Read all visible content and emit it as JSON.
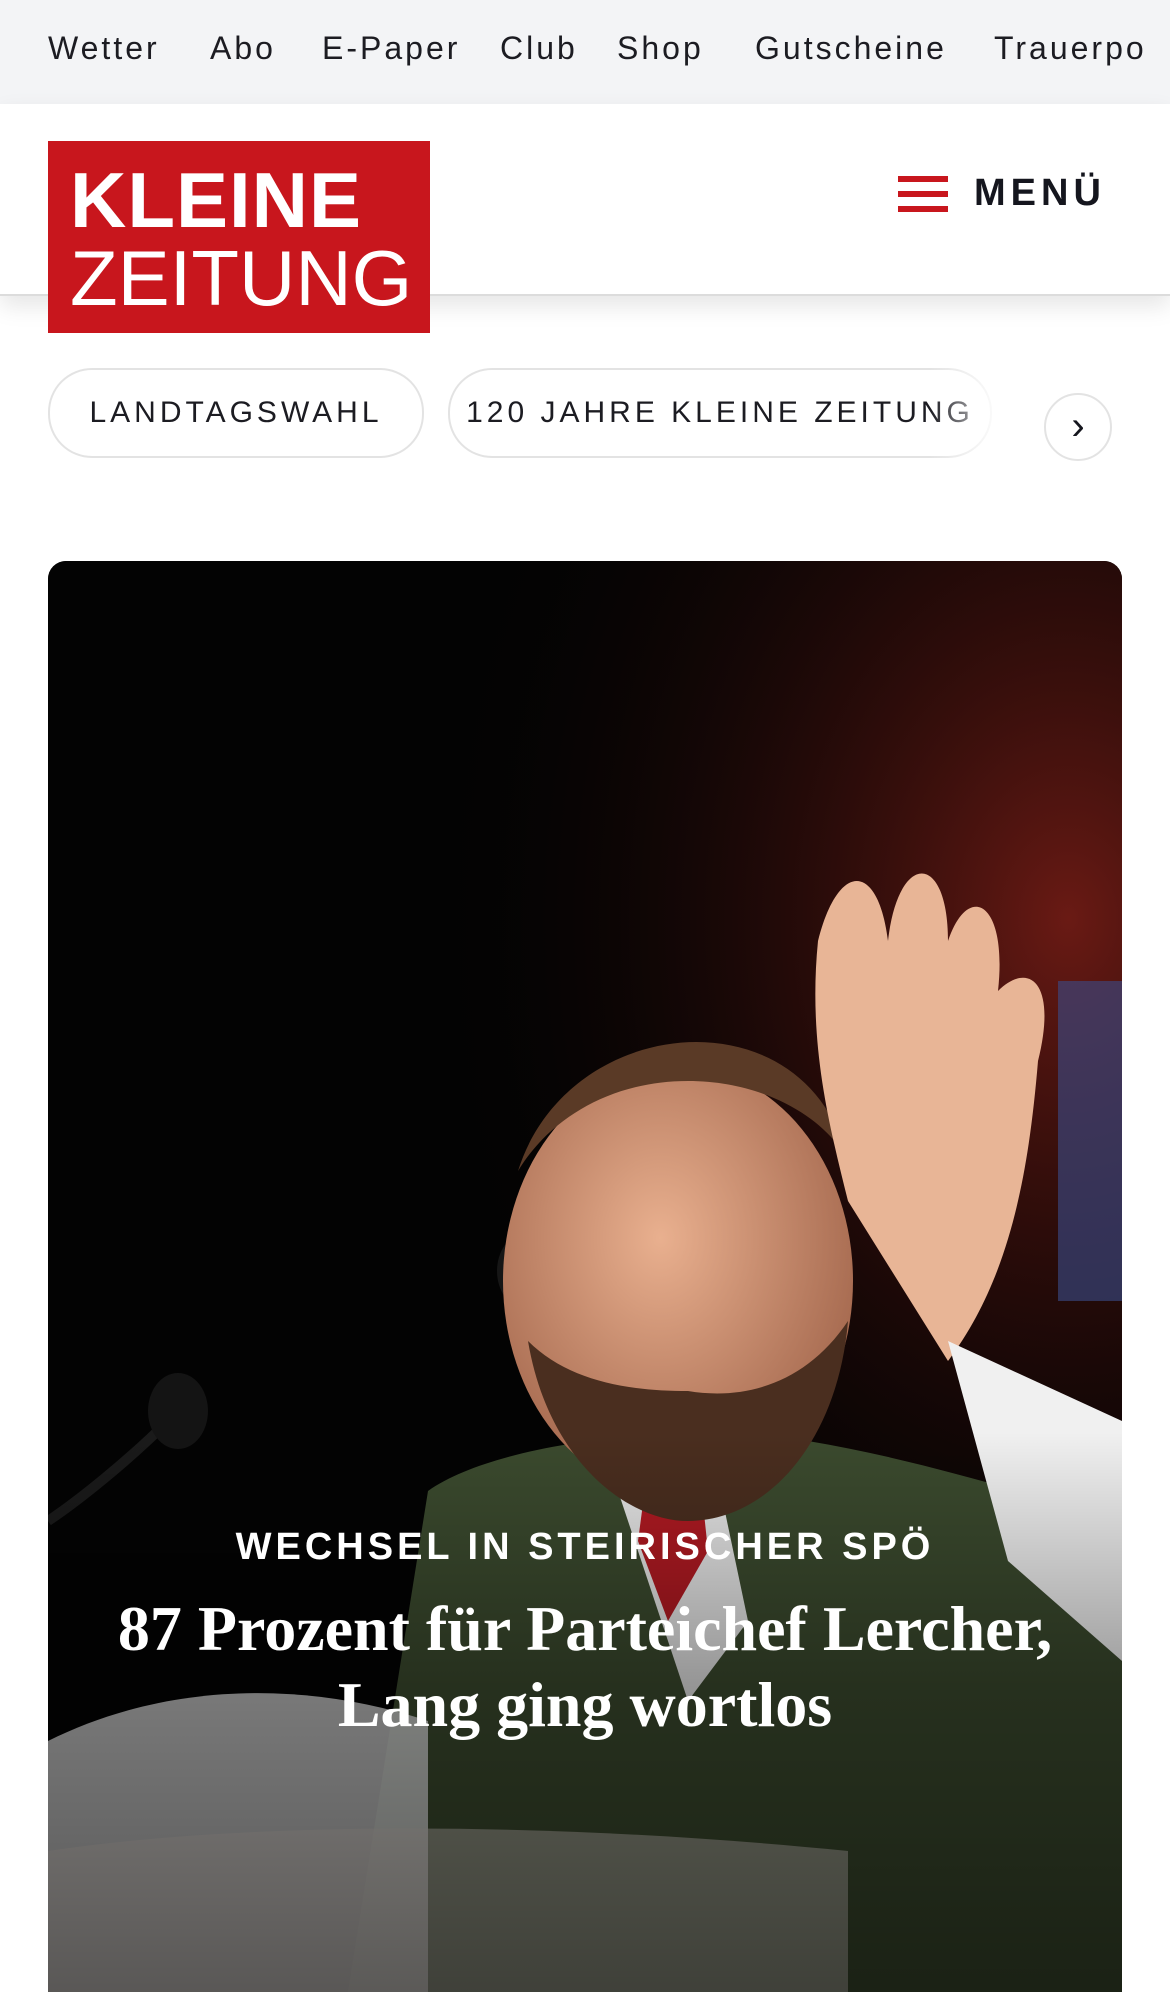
{
  "top_nav": {
    "items": [
      {
        "label": "Wetter"
      },
      {
        "label": "Abo"
      },
      {
        "label": "E-Paper"
      },
      {
        "label": "Club"
      },
      {
        "label": "Shop"
      },
      {
        "label": "Gutscheine"
      },
      {
        "label": "Trauerpo"
      }
    ]
  },
  "header": {
    "logo": {
      "line1": "KLEINE",
      "line2": "ZEITUNG"
    },
    "menu_label": "MENÜ",
    "brand_color": "#c8161d"
  },
  "topic_chips": [
    {
      "label": "LANDTAGSWAHL"
    },
    {
      "label": "120 JAHRE KLEINE ZEITUNG"
    }
  ],
  "chips_next_icon": "chevron-right-icon",
  "hero": {
    "kicker": "WECHSEL IN STEIRISCHER SPÖ",
    "headline": "87 Prozent für Parteichef Lercher, Lang ging wortlos"
  }
}
